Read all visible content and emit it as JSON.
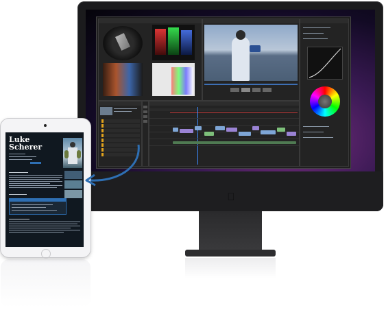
{
  "ipad": {
    "page_title": "Luke Scherer"
  },
  "colors": {
    "arrow": "#2e6fb3",
    "screen_gradient_center": "#7a2f7f",
    "clip_blue": "#7ea6d6",
    "clip_violet": "#9a83d4",
    "clip_green": "#7dbf7a",
    "panel_bg": "#232323"
  },
  "icons": {
    "apple_logo": "apple-logo-icon",
    "arrow": "curved-arrow-icon"
  }
}
